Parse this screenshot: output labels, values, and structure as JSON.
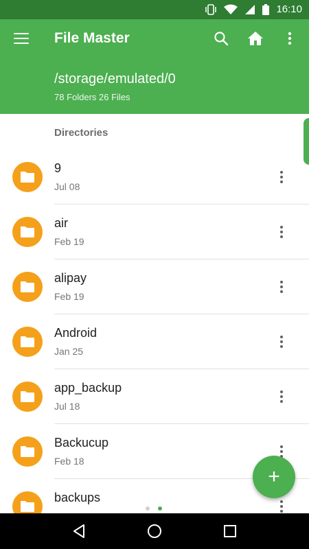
{
  "status_bar": {
    "time": "16:10",
    "icons": [
      "vibrate-icon",
      "wifi-icon",
      "signal-icon",
      "battery-icon"
    ]
  },
  "app_bar": {
    "title": "File Master",
    "path": "/storage/emulated/0",
    "counts": "78 Folders 26 Files",
    "icons": [
      "menu-icon",
      "search-icon",
      "home-icon",
      "overflow-menu-icon"
    ]
  },
  "section": {
    "header": "Directories"
  },
  "folders": [
    {
      "name": "9",
      "date": "Jul 08"
    },
    {
      "name": "air",
      "date": "Feb 19"
    },
    {
      "name": "alipay",
      "date": "Feb 19"
    },
    {
      "name": "Android",
      "date": "Jan 25"
    },
    {
      "name": "app_backup",
      "date": "Jul 18"
    },
    {
      "name": "Backucup",
      "date": "Feb 18"
    },
    {
      "name": "backups",
      "date": ""
    }
  ],
  "fab": {
    "label": "+"
  },
  "colors": {
    "status_bar": "#2e7d32",
    "primary": "#4caf50",
    "folder": "#f5a01a"
  },
  "nav_bar": {
    "icons": [
      "back-icon",
      "home-circle-icon",
      "recents-icon"
    ]
  }
}
